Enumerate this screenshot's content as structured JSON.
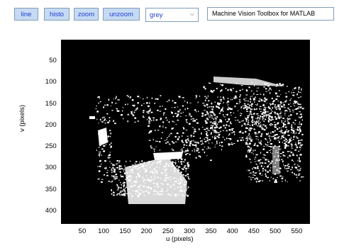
{
  "toolbar": {
    "buttons": [
      {
        "label": "line"
      },
      {
        "label": "histo"
      },
      {
        "label": "zoom"
      },
      {
        "label": "unzoom"
      }
    ],
    "colormap": {
      "selected": "grey"
    },
    "window_title": "Machine Vision Toolbox for MATLAB"
  },
  "plot": {
    "xlabel": "u (pixels)",
    "ylabel": "v (pixels)",
    "xticks": [
      "50",
      "100",
      "150",
      "200",
      "250",
      "300",
      "350",
      "400",
      "450",
      "500",
      "550"
    ],
    "yticks": [
      "50",
      "100",
      "150",
      "200",
      "250",
      "300",
      "350",
      "400"
    ],
    "xlim": [
      0,
      580
    ],
    "ylim": [
      0,
      430
    ]
  },
  "colors": {
    "button_bg": "#c6daf3",
    "button_text": "#1b3fd6",
    "image_bg": "#000000"
  }
}
